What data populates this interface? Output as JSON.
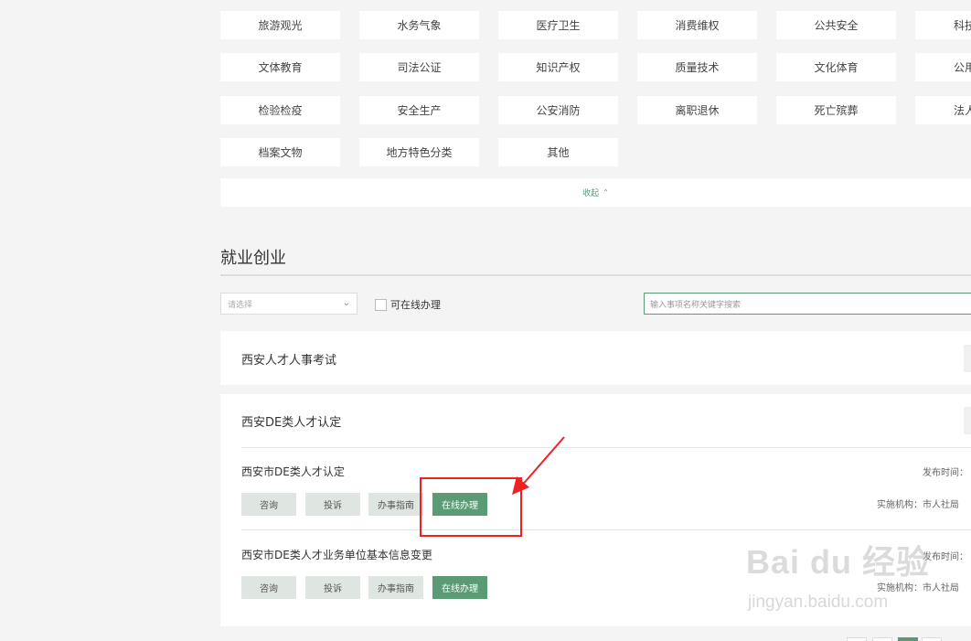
{
  "categories": {
    "row1": [
      "旅游观光",
      "水务气象",
      "医疗卫生",
      "消费维权",
      "公共安全",
      "科技"
    ],
    "row2": [
      "文体教育",
      "司法公证",
      "知识产权",
      "质量技术",
      "文化体育",
      "公用"
    ],
    "row3": [
      "检验检疫",
      "安全生产",
      "公安消防",
      "离职退休",
      "死亡殡葬",
      "法人"
    ],
    "row4": [
      "档案文物",
      "地方特色分类",
      "其他"
    ],
    "collapse_label": "收起",
    "collapse_icon": "double-chevron-up"
  },
  "section": {
    "title": "就业创业"
  },
  "filters": {
    "select_placeholder": "请选择",
    "online_checkbox_label": "可在线办理",
    "search_placeholder": "输入事项名称关键字搜索"
  },
  "panels": [
    {
      "title": "西安人才人事考试"
    },
    {
      "title": "西安DE类人才认定",
      "items": [
        {
          "title": "西安市DE类人才认定",
          "publish_label": "发布时间：",
          "org_label": "实施机构：市人社局",
          "actions": [
            "咨询",
            "投诉",
            "办事指南",
            "在线办理"
          ]
        },
        {
          "title": "西安市DE类人才业务单位基本信息变更",
          "publish_label": "发布时间：",
          "org_label": "实施机构：市人社局",
          "actions": [
            "咨询",
            "投诉",
            "办事指南",
            "在线办理"
          ]
        }
      ]
    }
  ],
  "watermark": {
    "logo": "Bai du 经验",
    "url": "jingyan.baidu.com"
  },
  "colors": {
    "accent": "#5a9a75",
    "annotation": "#e22222"
  }
}
